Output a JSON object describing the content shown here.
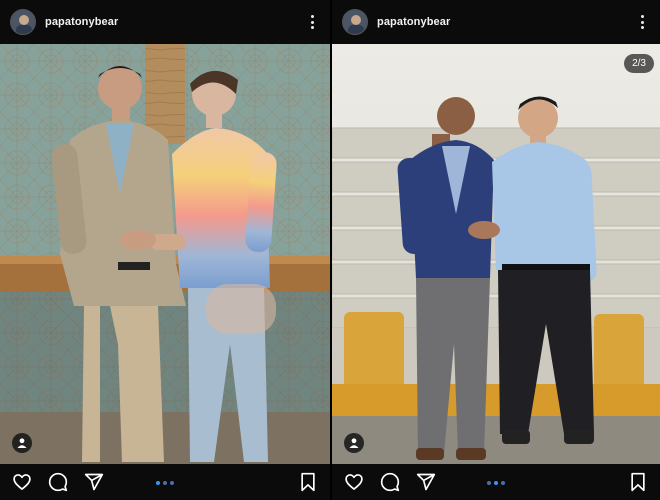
{
  "posts": [
    {
      "username": "papatonybear",
      "counter": "",
      "carousel_dots": 3,
      "active_dot": 0
    },
    {
      "username": "papatonybear",
      "counter": "2/3",
      "carousel_dots": 3,
      "active_dot": 1
    }
  ],
  "icons": {
    "like": "heart-icon",
    "comment": "comment-icon",
    "share": "send-icon",
    "save": "bookmark-icon",
    "tag": "user-tag-icon",
    "menu": "more-vertical-icon"
  },
  "colors": {
    "background": "#0b0b0b",
    "accent": "#3897f0"
  }
}
